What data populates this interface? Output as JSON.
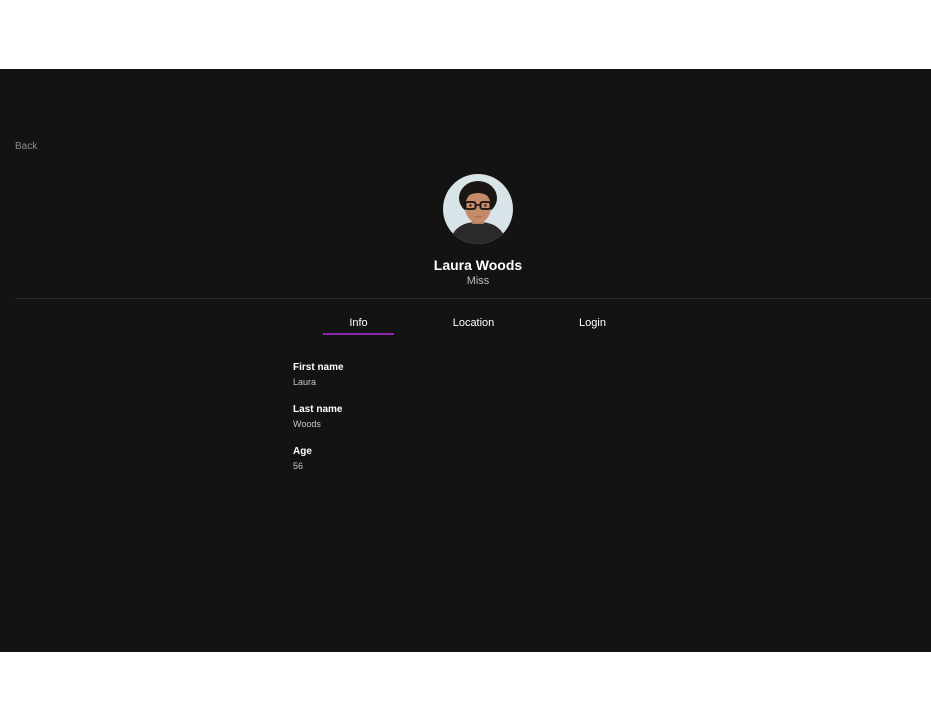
{
  "nav": {
    "back_label": "Back"
  },
  "profile": {
    "name": "Laura Woods",
    "title": "Miss",
    "avatar_icon": "user-photo"
  },
  "tabs": [
    {
      "label": "Info",
      "active": true
    },
    {
      "label": "Location",
      "active": false
    },
    {
      "label": "Login",
      "active": false
    }
  ],
  "info": {
    "first_name": {
      "label": "First name",
      "value": "Laura"
    },
    "last_name": {
      "label": "Last name",
      "value": "Woods"
    },
    "age": {
      "label": "Age",
      "value": "56"
    }
  },
  "colors": {
    "background": "#131313",
    "accent": "#8e24aa",
    "text": "#ffffff"
  }
}
